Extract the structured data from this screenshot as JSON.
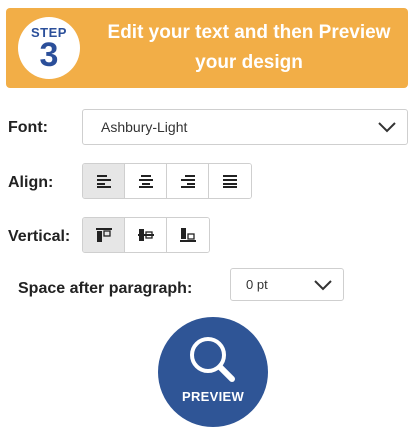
{
  "banner": {
    "step_word": "STEP",
    "step_number": "3",
    "line1": "Edit your text and then Preview",
    "line2": "your design",
    "color": "#f2ae47"
  },
  "font": {
    "label": "Font:",
    "value": "Ashbury-Light"
  },
  "align": {
    "label": "Align:",
    "options": [
      "align-left-icon",
      "align-center-icon",
      "align-right-icon",
      "align-justify-icon"
    ],
    "selected": "align-left-icon"
  },
  "vertical": {
    "label": "Vertical:",
    "options": [
      "vertical-top-icon",
      "vertical-middle-icon",
      "vertical-bottom-icon"
    ],
    "selected": "vertical-top-icon"
  },
  "spacing": {
    "label": "Space after paragraph:",
    "value": "0 pt"
  },
  "preview": {
    "label": "PREVIEW",
    "icon": "magnifier-icon",
    "color": "#2f5596"
  }
}
